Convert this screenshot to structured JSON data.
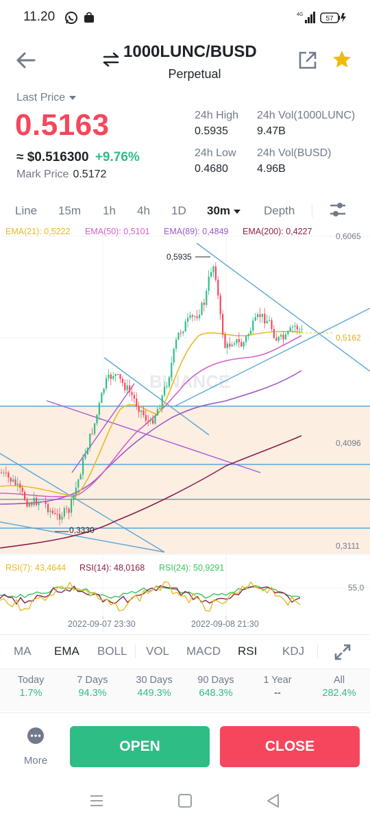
{
  "status": {
    "time": "11.20",
    "network": "4G",
    "battery": "57"
  },
  "header": {
    "pair": "1000LUNC/BUSD",
    "subtitle": "Perpetual"
  },
  "price": {
    "last_price_label": "Last Price",
    "last_price": "0.5163",
    "usd_price": "≈ $0.516300",
    "change_pct": "+9.76%",
    "mark_label": "Mark Price",
    "mark_value": "0.5172"
  },
  "stats": {
    "high_label": "24h High",
    "high_value": "0.5935",
    "vol_coin_label": "24h Vol(1000LUNC)",
    "vol_coin_value": "9.47B",
    "low_label": "24h Low",
    "low_value": "0.4680",
    "vol_quote_label": "24h Vol(BUSD)",
    "vol_quote_value": "4.96B"
  },
  "timeframes": [
    "Line",
    "15m",
    "1h",
    "4h",
    "1D",
    "30m",
    "Depth"
  ],
  "active_timeframe": "30m",
  "ema_legend": {
    "ema21": "EMA(21): 0,5222",
    "ema50": "EMA(50): 0,5101",
    "ema89": "EMA(89): 0,4849",
    "ema200": "EMA(200): 0,4227"
  },
  "chart_labels": {
    "y_top": "0,6065",
    "y_current": "0,5162",
    "y_mid": "0,4096",
    "y_low": "0,3111",
    "high_marker": "0,5935",
    "low_marker": "0,3330",
    "watermark": "BINANCE",
    "rsi_level": "55,0",
    "date1": "2022-09-07 23:30",
    "date2": "2022-09-08 21:30"
  },
  "rsi_legend": {
    "rsi7": "RSI(7): 43,4644",
    "rsi14": "RSI(14): 48,0168",
    "rsi24": "RSI(24): 50,9291"
  },
  "indicators": [
    "MA",
    "EMA",
    "BOLL",
    "VOL",
    "MACD",
    "RSI",
    "KDJ"
  ],
  "performance": [
    {
      "label": "Today",
      "value": "1.7%"
    },
    {
      "label": "7 Days",
      "value": "94.3%"
    },
    {
      "label": "30 Days",
      "value": "449.3%"
    },
    {
      "label": "90 Days",
      "value": "648.3%"
    },
    {
      "label": "1 Year",
      "value": "--"
    },
    {
      "label": "All",
      "value": "282.4%"
    }
  ],
  "actions": {
    "more": "More",
    "open": "OPEN",
    "close": "CLOSE"
  },
  "colors": {
    "up": "#2ebd85",
    "down": "#f6465d",
    "star": "#f0b90b",
    "ema21": "#e8b923",
    "ema50": "#d35fc6",
    "ema89": "#9b59c9",
    "ema200": "#8b1f4a"
  },
  "icons": [
    "whatsapp-icon",
    "shopping-bag-icon",
    "signal-icon",
    "battery-icon",
    "back-arrow-icon",
    "swap-icon",
    "share-icon",
    "star-icon",
    "settings-sliders-icon",
    "expand-icon",
    "more-dots-icon",
    "nav-recents-icon",
    "nav-home-icon",
    "nav-back-icon"
  ]
}
